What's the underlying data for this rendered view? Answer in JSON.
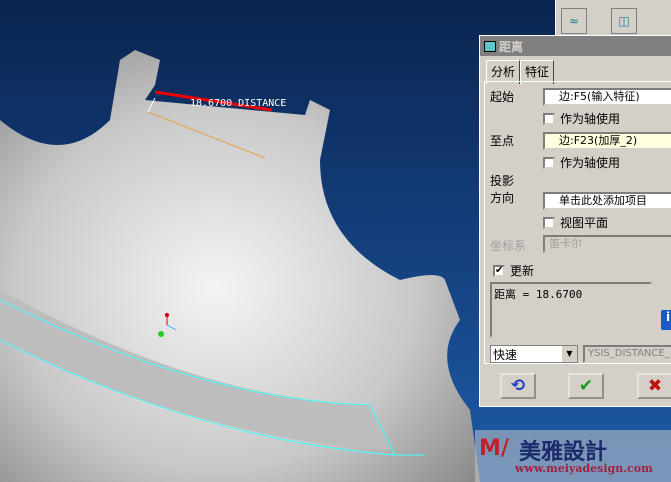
{
  "viewport": {
    "dimension_label": "18.6700  DISTANCE"
  },
  "dialog": {
    "title": "距离",
    "tabs": [
      "分析",
      "特征"
    ],
    "from_label": "起始",
    "from_value": "边:F5(输入特征)",
    "from_axis": "作为轴使用",
    "to_label": "至点",
    "to_value": "边:F23(加厚_2)",
    "to_axis": "作为轴使用",
    "projection_label": "投影",
    "direction_label": "方向",
    "direction_value": "单击此处添加项目",
    "view_plane": "视图平面",
    "csys_label": "坐标系",
    "csys_value": "笛卡尔",
    "update_label": "更新",
    "result": "距离 = 18.6700",
    "mode": "快速",
    "name_value": "YSIS_DISTANCE_"
  },
  "watermark": {
    "brand": "美雅設計",
    "url": "www.meiyadesign.com"
  },
  "colors": {
    "bg": "#0d3470",
    "panel": "#d4d0c8",
    "highlight": "#ffffe0"
  }
}
